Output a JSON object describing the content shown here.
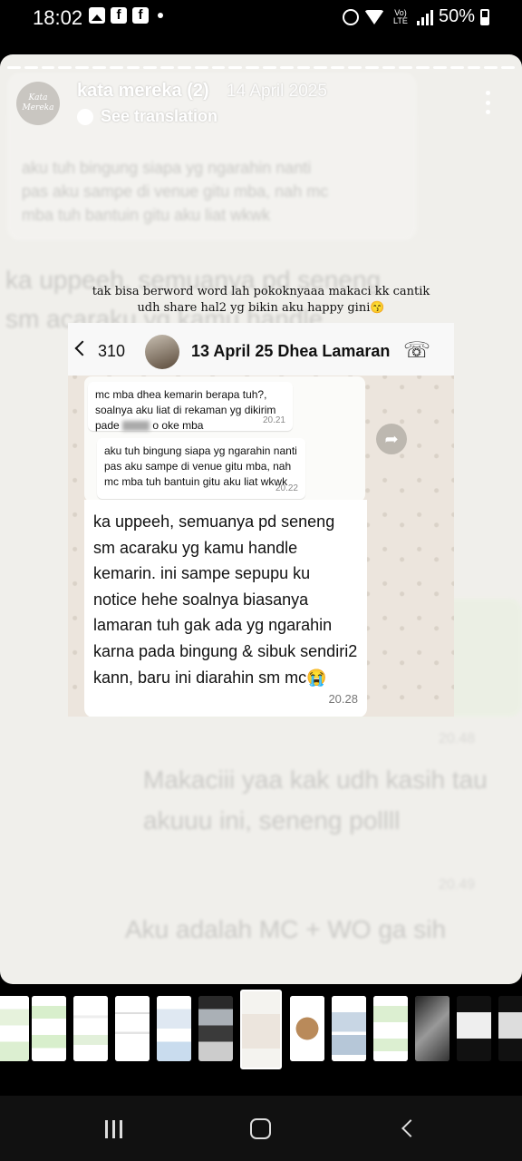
{
  "status_bar": {
    "time": "18:02",
    "network": "Vo) LTE",
    "battery": "50%"
  },
  "story": {
    "username": "kata mereka (2)",
    "date": "14 April 2025",
    "translation_label": "See translation",
    "avatar_text": "Kata Mereka",
    "caption_line1": "tak bisa berword word lah pokoknyaaa makaci kk cantik",
    "caption_line2": "udh share hal2 yg bikin aku happy gini😙"
  },
  "chat": {
    "back_count": "310",
    "contact_name": "13 April 25 Dhea Lamaran",
    "quoted": [
      {
        "text_before": "mc mba dhea kemarin berapa tuh?, soalnya aku liat di rekaman yg dikirim pade",
        "text_after": "o oke mba",
        "time": "20.21"
      },
      {
        "text": "aku tuh bingung siapa yg ngarahin nanti pas aku sampe di venue gitu mba, nah mc mba tuh bantuin gitu aku liat wkwk",
        "time": "20.22"
      }
    ],
    "main_message": "ka uppeeh, semuanya pd seneng sm acaraku yg kamu handle kemarin. ini sampe sepupu ku notice hehe soalnya biasanya lamaran tuh gak ada yg ngarahin karna pada bingung & sibuk sendiri2 kann, baru ini diarahin sm mc😭",
    "main_time": "20.28"
  },
  "background_ghost": {
    "line1": "ka uppeeh, semuanya pd seneng",
    "line2": "sm acaraku yg kamu handle",
    "reply1": "Makaciii yaa kak udh kasih tau",
    "reply2": "akuuu ini, seneng pollll",
    "reply3": "Aku adalah MC + WO ga sih",
    "time1": "20.48",
    "time2": "20.49"
  },
  "colors": {
    "story_bg": "#f0efeb",
    "chat_bg": "#ece5dd",
    "bubble": "#ffffff"
  },
  "icons": {
    "more": "more-vertical-icon",
    "translate": "translate-icon",
    "call_add": "call-add-icon",
    "forward": "forward-icon"
  }
}
